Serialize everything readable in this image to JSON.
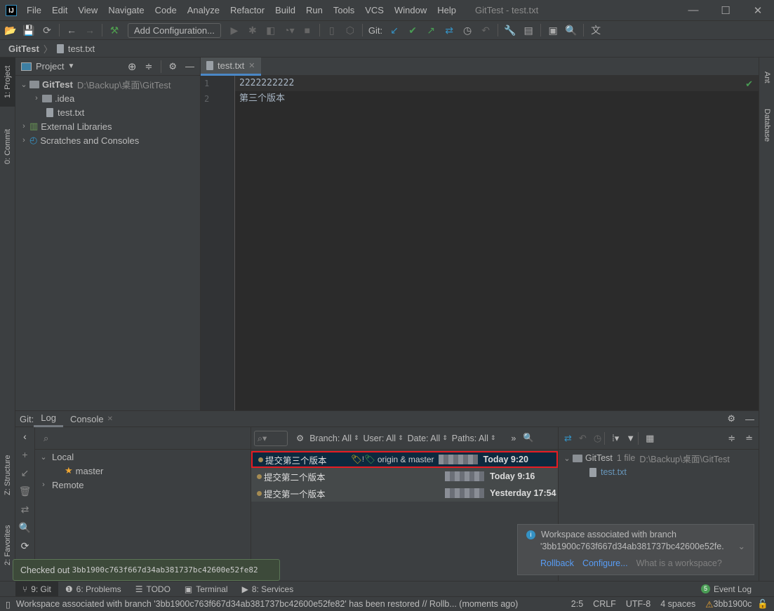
{
  "window": {
    "title": "GitTest - test.txt",
    "minimize": "—",
    "maximize": "☐",
    "close": "✕"
  },
  "menu": [
    "File",
    "Edit",
    "View",
    "Navigate",
    "Code",
    "Analyze",
    "Refactor",
    "Build",
    "Run",
    "Tools",
    "VCS",
    "Window",
    "Help"
  ],
  "toolbar": {
    "add_configuration": "Add Configuration...",
    "git_label": "Git:"
  },
  "breadcrumb": {
    "project": "GitTest",
    "file": "test.txt"
  },
  "left_stripe": {
    "project": "1: Project",
    "commit": "0: Commit",
    "structure": "Z: Structure",
    "favorites": "2: Favorites"
  },
  "right_stripe": {
    "ant": "Ant",
    "database": "Database"
  },
  "project_panel": {
    "title": "Project",
    "tree": [
      {
        "name": "GitTest",
        "path": "D:\\Backup\\桌面\\GitTest"
      },
      {
        "name": ".idea"
      },
      {
        "name": "test.txt"
      },
      {
        "name": "External Libraries"
      },
      {
        "name": "Scratches and Consoles"
      }
    ]
  },
  "editor": {
    "tab": "test.txt",
    "lines": [
      {
        "no": "1",
        "text": "2222222222"
      },
      {
        "no": "2",
        "text": "第三个版本"
      }
    ]
  },
  "git_panel": {
    "label": "Git:",
    "tabs": [
      "Log",
      "Console"
    ],
    "branches": {
      "local": "Local",
      "master": "master",
      "remote": "Remote"
    },
    "filters": {
      "branch": "Branch: All",
      "user": "User: All",
      "date": "Date: All",
      "paths": "Paths: All"
    },
    "commits": [
      {
        "message": "提交第三个版本",
        "refs": "origin & master",
        "date": "Today 9:20",
        "selected": true
      },
      {
        "message": "提交第二个版本",
        "date": "Today 9:16"
      },
      {
        "message": "提交第一个版本",
        "date": "Yesterday 17:54"
      }
    ],
    "details": {
      "root": "GitTest",
      "count": "1 file",
      "path": "D:\\Backup\\桌面\\GitTest",
      "file": "test.txt"
    }
  },
  "tooltip": {
    "prefix": "Checked out",
    "hash": "3bb1900c763f667d34ab381737bc42600e52fe82"
  },
  "notification": {
    "line1": "Workspace associated with branch",
    "line2": "'3bb1900c763f667d34ab381737bc42600e52fe.",
    "actions": [
      "Rollback",
      "Configure...",
      "What is a workspace?"
    ]
  },
  "tool_windows": [
    "9: Git",
    "6: Problems",
    "TODO",
    "Terminal",
    "8: Services"
  ],
  "event_log": {
    "badge": "5",
    "label": "Event Log"
  },
  "status": {
    "message": "Workspace associated with branch '3bb1900c763f667d34ab381737bc42600e52fe82' has been restored // Rollb... (moments ago)",
    "position": "2:5",
    "line_sep": "CRLF",
    "encoding": "UTF-8",
    "indent": "4 spaces",
    "branch": "3bb1900c"
  },
  "colors": {
    "accent": "#4a88c7",
    "selection": "#0d293e",
    "highlight_border": "#e51c23",
    "tooltip_bg": "#3d4a3a"
  }
}
